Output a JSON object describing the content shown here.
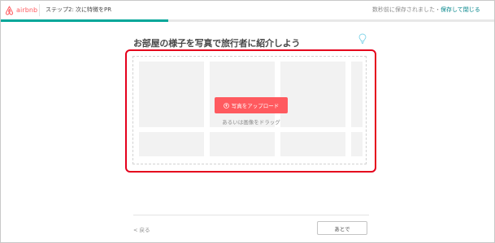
{
  "header": {
    "logo_text": "airbnb",
    "step_title": "ステップ2: 次に特徴をPR",
    "autosave_status": "数秒前に保存されました・",
    "save_exit_label": "保存して閉じる"
  },
  "progress": {
    "fraction": 0.34
  },
  "main": {
    "heading": "お部屋の様子を写真で旅行者に紹介しよう",
    "upload_button_label": "写真をアップロード",
    "drag_text": "あるいは画像をドラッグ"
  },
  "footer": {
    "back_label": "< 戻る",
    "next_label": "あとで"
  },
  "icons": {
    "logo": "airbnb-logo-icon",
    "tip": "lightbulb-icon",
    "upload": "upload-icon"
  },
  "colors": {
    "brand": "#ff5a5f",
    "progress": "#00a699",
    "link": "#008489",
    "highlight": "#e5001c"
  }
}
